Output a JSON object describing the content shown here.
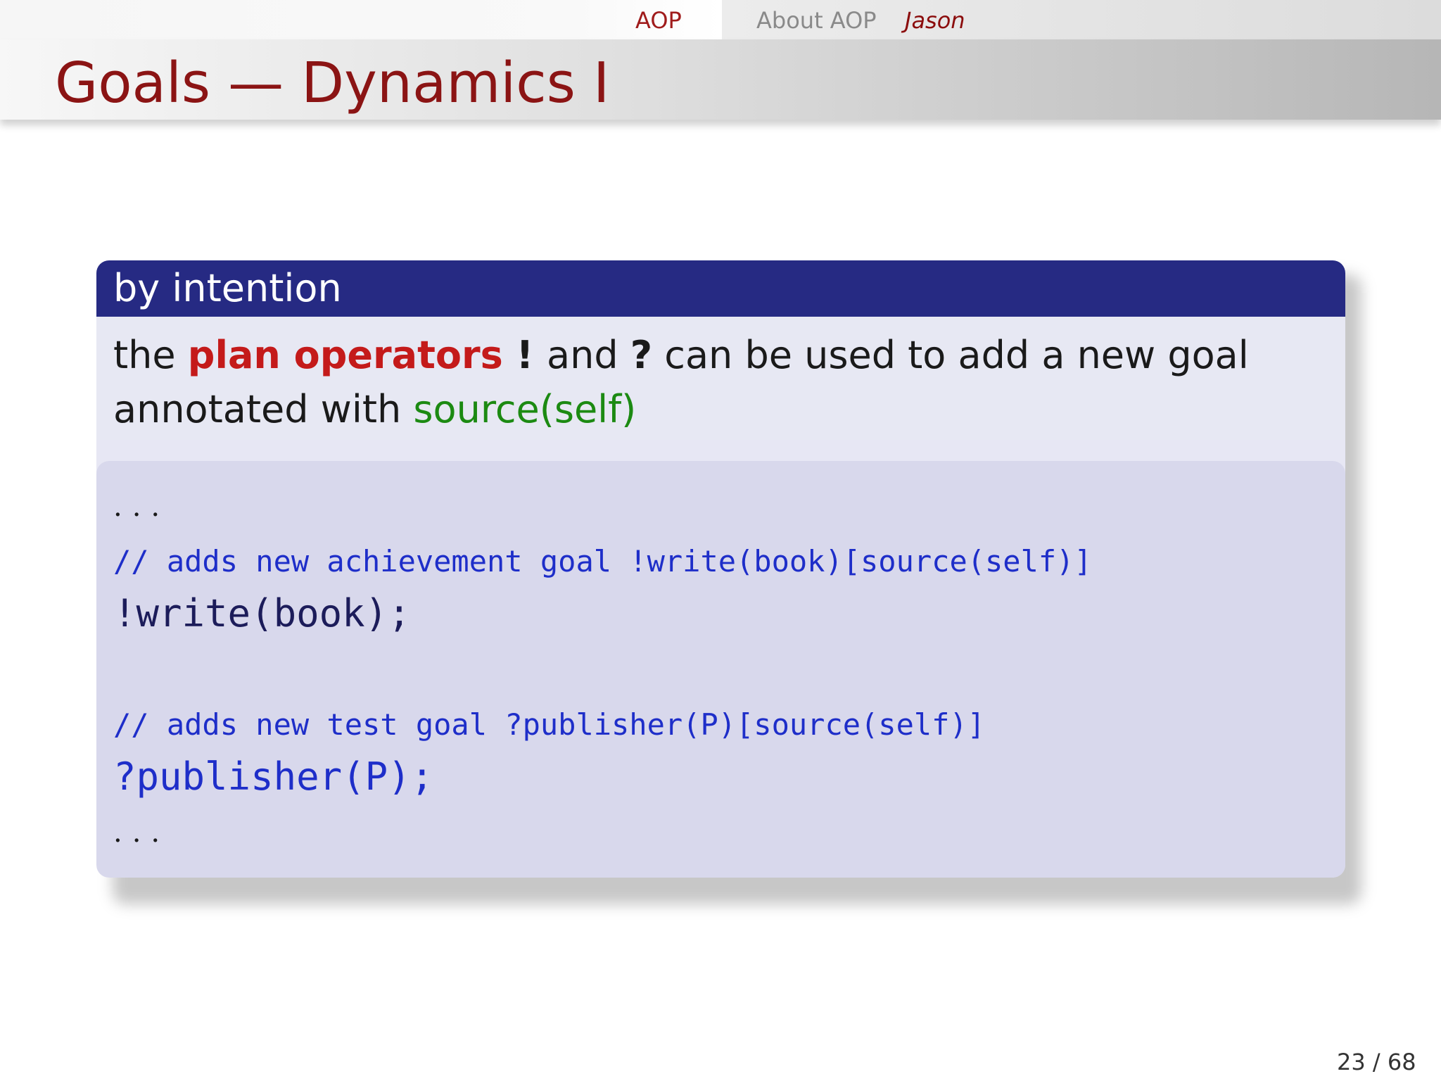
{
  "navbar": {
    "section": "AOP",
    "subsection": "About AOP",
    "topic": "Jason"
  },
  "frame": {
    "title": "Goals — Dynamics I"
  },
  "block": {
    "title": "by intention",
    "line1": {
      "prefix": "the ",
      "highlight": "plan operators",
      "op1": " ! ",
      "mid": "and ",
      "op2": "?",
      "suffix": " can be used to add a new goal"
    },
    "line2": {
      "prefix": "annotated with ",
      "annotation": "source(self)"
    }
  },
  "code": {
    "dots_top": "...",
    "comment1": "// adds new achievement goal !write(book)[source(self)]",
    "stmt1": "!write(book);",
    "comment2": "// adds new test goal ?publisher(P)[source(self)]",
    "stmt2": "?publisher(P);",
    "dots_bottom": "..."
  },
  "footer": {
    "page": "23 / 68"
  },
  "colors": {
    "accent": "#8b1414",
    "block_header": "#262a83",
    "alert": "#c41a1a",
    "annotation": "#1c8a12",
    "code_comment": "#1e2ec9"
  }
}
